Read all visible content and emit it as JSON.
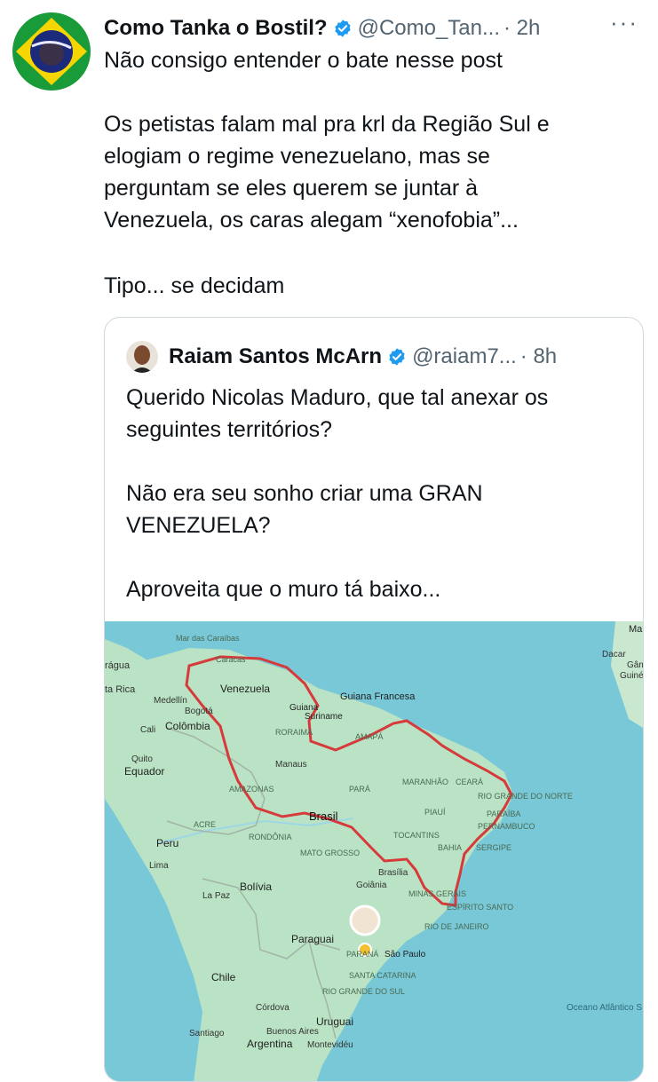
{
  "tweet": {
    "author_name": "Como Tanka o Bostil?",
    "handle": "@Como_Tan...",
    "time": "· 2h",
    "more": "···",
    "lines": [
      "Não consigo entender o bate nesse post",
      "Os petistas falam mal pra krl da Região Sul e",
      "elogiam o regime venezuelano, mas se",
      "perguntam se eles querem se juntar à",
      "Venezuela, os caras alegam “xenofobia”...",
      "Tipo... se decidam"
    ]
  },
  "quote": {
    "author_name": "Raiam Santos McArn",
    "handle": "@raiam7...",
    "time": "· 8h",
    "lines": [
      "Querido Nicolas Maduro, que tal anexar os",
      "seguintes territórios?",
      "Não era seu sonho criar uma GRAN",
      "VENEZUELA?",
      "Aproveita que o muro tá baixo..."
    ]
  },
  "map": {
    "labels": {
      "caribe": "Mar das Caraíbas",
      "caracas": "Caracas",
      "venezuela": "Venezuela",
      "guiana": "Guiana",
      "guiana_fr": "Guiana Francesa",
      "suriname": "Suriname",
      "medellin": "Medellín",
      "bogota": "Bogotá",
      "cali": "Cali",
      "colombia": "Colômbia",
      "quito": "Quito",
      "equador": "Equador",
      "roraima": "RORAIMA",
      "amapa": "AMAPÁ",
      "manaus": "Manaus",
      "amazonas": "AMAZONAS",
      "para": "PARÁ",
      "maranhao": "MARANHÃO",
      "ceara": "CEARÁ",
      "rn": "RIO GRANDE DO NORTE",
      "piaui": "PIAUÍ",
      "paraiba": "PARAÍBA",
      "pernambuco": "PERNAMBUCO",
      "acre": "ACRE",
      "brasil": "Brasil",
      "tocantins": "TOCANTINS",
      "bahia": "BAHIA",
      "sergipe": "SERGIPE",
      "rondonia": "RONDÔNIA",
      "mato_grosso": "MATO GROSSO",
      "peru": "Peru",
      "lima": "Lima",
      "brasilia": "Brasília",
      "goiania": "Goiânia",
      "minas": "MINAS GERAIS",
      "bolivia": "Bolívia",
      "la_paz": "La Paz",
      "espirito_santo": "ESPÍRITO SANTO",
      "rio": "RIO DE JANEIRO",
      "paraguai": "Paraguai",
      "parana": "PARANÁ",
      "sao_paulo": "São Paulo",
      "chile": "Chile",
      "santa_catarina": "SANTA CATARINA",
      "rgs": "RIO GRANDE DO SUL",
      "cordova": "Córdova",
      "uruguai": "Uruguai",
      "santiago": "Santiago",
      "buenos_aires": "Buenos Aires",
      "argentina": "Argentina",
      "montevideu": "Montevidéu",
      "oceano": "Oceano Atlântico S",
      "nicaragua": "rágua",
      "costa_rica": "ta Rica",
      "dacar": "Dacar",
      "gamb": "Gâmb",
      "guine": "Guiné-",
      "ma": "Ma"
    }
  },
  "colors": {
    "ocean": "#78c8d8",
    "land": "#b9e3c4",
    "border": "#d63a3a",
    "verified": "#1d9bf0"
  }
}
